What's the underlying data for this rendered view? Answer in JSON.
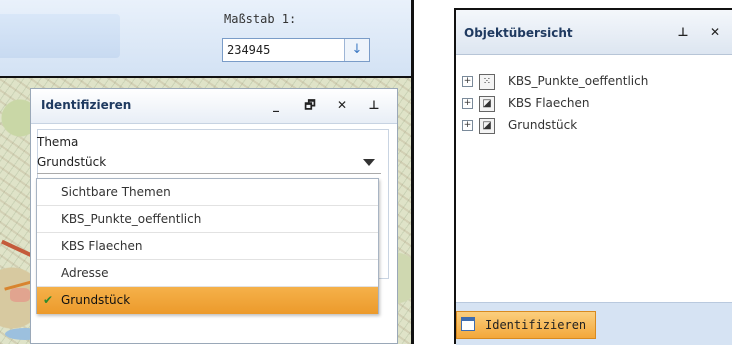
{
  "scale": {
    "label": "Maßstab 1:",
    "value": "234945",
    "submit_icon": "arrow-down-icon"
  },
  "identify_window": {
    "title": "Identifizieren",
    "buttons": [
      "_",
      "🗗",
      "✕",
      "⊥"
    ],
    "thema_label": "Thema",
    "thema_selected": "Grundstück"
  },
  "dropdown": {
    "items": [
      "Sichtbare Themen",
      "KBS_Punkte_oeffentlich",
      "KBS Flaechen",
      "Adresse",
      "Grundstück"
    ],
    "checked_index": 4
  },
  "object_overview": {
    "title": "Objektübersicht",
    "buttons": [
      "⊥",
      "✕"
    ],
    "layers": [
      {
        "label": "KBS_Punkte_oeffentlich",
        "icon": "point-layer-icon",
        "glyph": "⁙"
      },
      {
        "label": "KBS Flaechen",
        "icon": "polygon-layer-icon",
        "glyph": "◪"
      },
      {
        "label": "Grundstück",
        "icon": "polygon-layer-icon",
        "glyph": "◪"
      }
    ],
    "tab_label": "Identifizieren"
  },
  "colors": {
    "accent": "#f3a73a",
    "header": "#1f3a60",
    "check": "#2e8b2e"
  }
}
